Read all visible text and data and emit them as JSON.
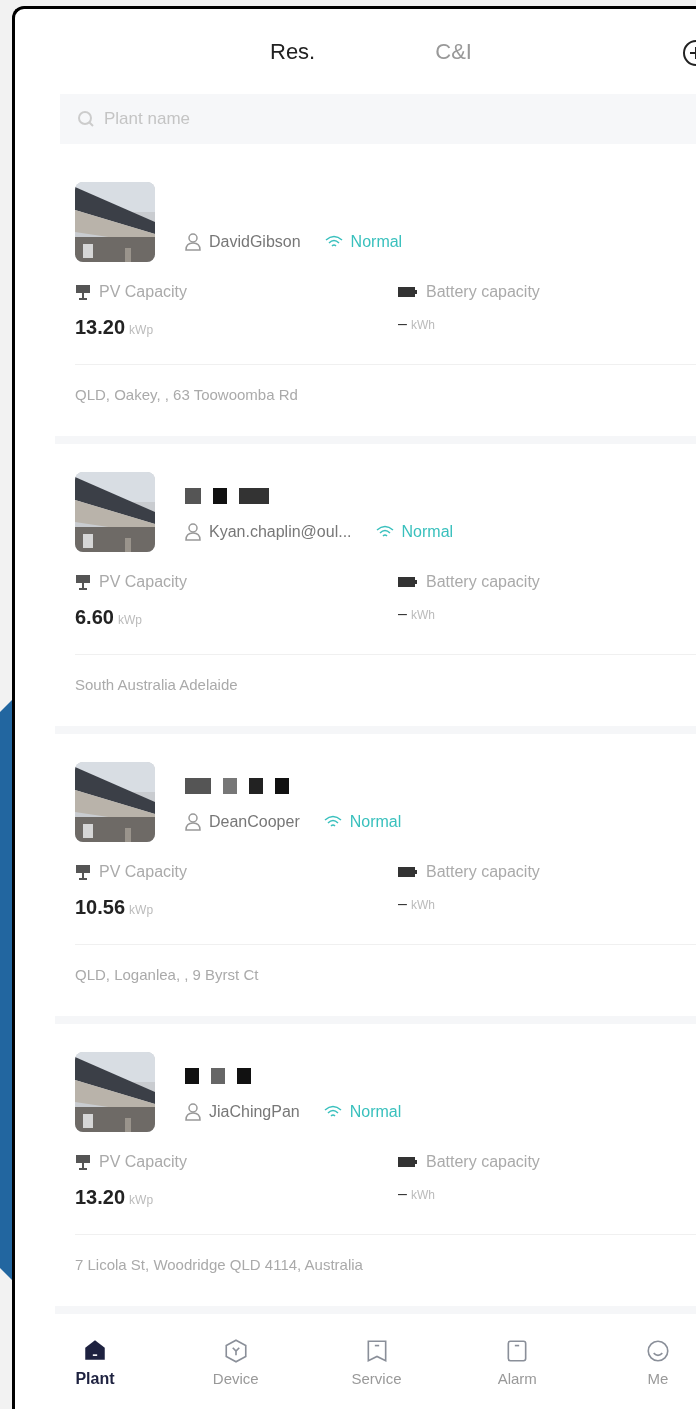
{
  "header": {
    "tabs": [
      {
        "label": "Res.",
        "selected": true
      },
      {
        "label": "C&I",
        "selected": false
      }
    ]
  },
  "search": {
    "placeholder": "Plant name"
  },
  "plants": [
    {
      "owner": "DavidGibson",
      "status": "Normal",
      "pv_label": "PV Capacity",
      "pv_value": "13.20",
      "pv_unit": "kWp",
      "battery_label": "Battery capacity",
      "battery_value": "–",
      "battery_unit": "kWh",
      "address": "QLD, Oakey, , 63 Toowoomba Rd",
      "name_redacted": false
    },
    {
      "owner": "Kyan.chaplin@oul...",
      "status": "Normal",
      "pv_label": "PV Capacity",
      "pv_value": "6.60",
      "pv_unit": "kWp",
      "battery_label": "Battery capacity",
      "battery_value": "–",
      "battery_unit": "kWh",
      "address": "South Australia Adelaide",
      "name_redacted": true
    },
    {
      "owner": "DeanCooper",
      "status": "Normal",
      "pv_label": "PV Capacity",
      "pv_value": "10.56",
      "pv_unit": "kWp",
      "battery_label": "Battery capacity",
      "battery_value": "–",
      "battery_unit": "kWh",
      "address": "QLD, Loganlea, , 9 Byrst Ct",
      "name_redacted": true
    },
    {
      "owner": "JiaChingPan",
      "status": "Normal",
      "pv_label": "PV Capacity",
      "pv_value": "13.20",
      "pv_unit": "kWp",
      "battery_label": "Battery capacity",
      "battery_value": "–",
      "battery_unit": "kWh",
      "address": "7 Licola St, Woodridge QLD 4114, Australia",
      "name_redacted": true
    }
  ],
  "tab_bar": [
    {
      "label": "Plant",
      "kind": "home",
      "selected": true
    },
    {
      "label": "Device",
      "kind": "device",
      "selected": false
    },
    {
      "label": "Service",
      "kind": "service",
      "selected": false
    },
    {
      "label": "Alarm",
      "kind": "alarm",
      "selected": false
    },
    {
      "label": "Me",
      "kind": "me",
      "selected": false
    }
  ]
}
